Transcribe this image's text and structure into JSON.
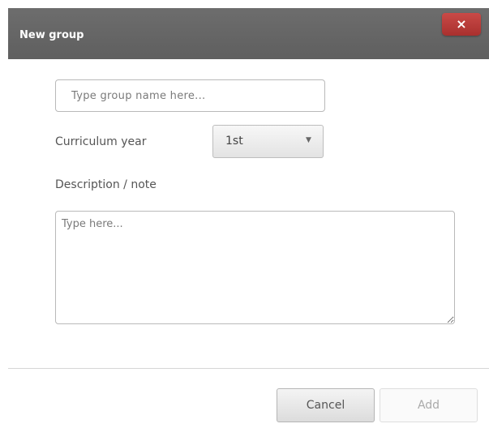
{
  "dialog": {
    "title": "New group",
    "close_label": "×"
  },
  "form": {
    "name_placeholder": "Type group name here...",
    "curriculum_label": "Curriculum year",
    "curriculum_value": "1st",
    "description_label": "Description / note",
    "description_placeholder": "Type here..."
  },
  "footer": {
    "cancel_label": "Cancel",
    "add_label": "Add"
  },
  "colors": {
    "titlebar": "#666666",
    "close_button": "#b93c39",
    "add_disabled_text": "#aaaaaa"
  }
}
